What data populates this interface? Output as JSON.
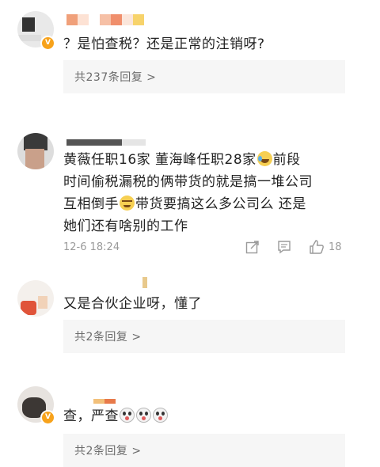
{
  "comments": [
    {
      "text": "？是怕查税？还是正常的注销呀?",
      "reply_summary": "共237条回复 >"
    },
    {
      "text_line1_a": "黄薇任职16家 董海峰任职28家",
      "text_line1_b": "前段",
      "text_line2": "时间偷税漏税的俩带货的就是搞一堆公司",
      "text_line3_a": "互相倒手",
      "text_line3_b": "带货要搞这么多公司么 还是",
      "text_line4": "她们还有啥别的工作",
      "timestamp": "12-6 18:24",
      "like_count": "18",
      "icons": [
        "share-icon",
        "comment-icon",
        "like-icon"
      ]
    },
    {
      "text": "又是合伙企业呀，懂了",
      "reply_summary": "共2条回复 >"
    },
    {
      "text": "查，严查",
      "reply_summary": "共2条回复 >"
    }
  ],
  "colors": {
    "reply_bg": "#f6f6f6",
    "meta": "#9a9a9a",
    "badge": "#f7a21b"
  }
}
